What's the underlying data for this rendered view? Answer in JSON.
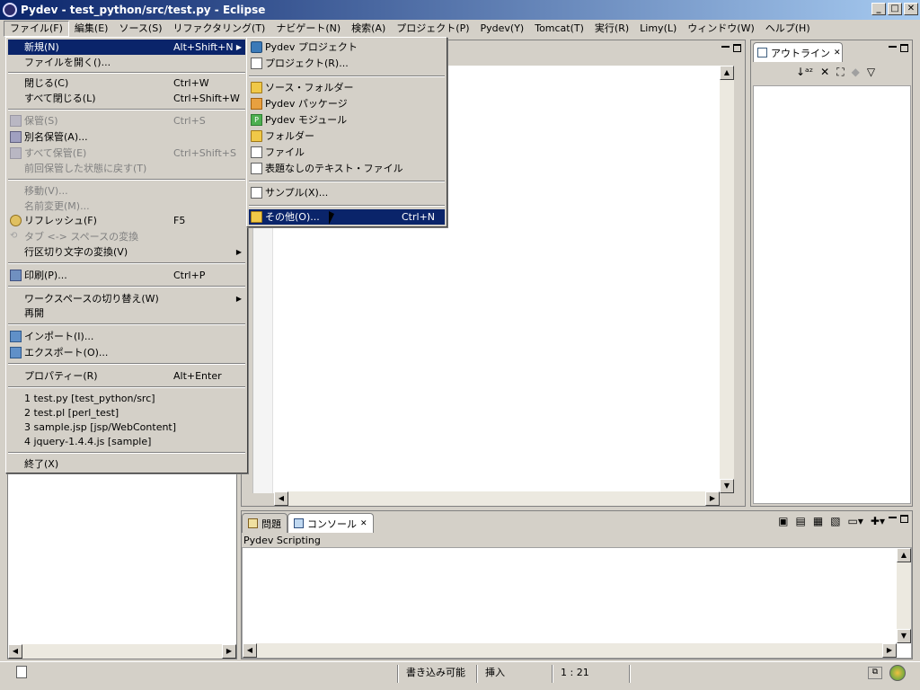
{
  "window": {
    "title": "Pydev - test_python/src/test.py - Eclipse",
    "btn_min": "_",
    "btn_max": "□",
    "btn_close": "✕"
  },
  "menubar": [
    "ファイル(F)",
    "編集(E)",
    "ソース(S)",
    "リファクタリング(T)",
    "ナビゲート(N)",
    "検索(A)",
    "プロジェクト(P)",
    "Pydev(Y)",
    "Tomcat(T)",
    "実行(R)",
    "Limy(L)",
    "ウィンドウ(W)",
    "ヘルプ(H)"
  ],
  "file_menu": {
    "new": {
      "label": "新規(N)",
      "accel": "Alt+Shift+N"
    },
    "open_file": "ファイルを開く()...",
    "close": {
      "label": "閉じる(C)",
      "accel": "Ctrl+W"
    },
    "close_all": {
      "label": "すべて閉じる(L)",
      "accel": "Ctrl+Shift+W"
    },
    "save": {
      "label": "保管(S)",
      "accel": "Ctrl+S"
    },
    "save_as": "別名保管(A)...",
    "save_all": {
      "label": "すべて保管(E)",
      "accel": "Ctrl+Shift+S"
    },
    "revert": "前回保管した状態に戻す(T)",
    "move": "移動(V)...",
    "rename": "名前変更(M)...",
    "refresh": {
      "label": "リフレッシュ(F)",
      "accel": "F5"
    },
    "tab_space": "タブ <-> スペースの変換",
    "line_delim": "行区切り文字の変換(V)",
    "print": {
      "label": "印刷(P)...",
      "accel": "Ctrl+P"
    },
    "switch_ws": "ワークスペースの切り替え(W)",
    "restart": "再開",
    "import": "インポート(I)...",
    "export": "エクスポート(O)...",
    "properties": {
      "label": "プロパティー(R)",
      "accel": "Alt+Enter"
    },
    "recent": [
      "1 test.py  [test_python/src]",
      "2 test.pl  [perl_test]",
      "3 sample.jsp  [jsp/WebContent]",
      "4 jquery-1.4.4.js  [sample]"
    ],
    "exit": "終了(X)"
  },
  "new_menu": {
    "pydev_project": "Pydev プロジェクト",
    "project": "プロジェクト(R)...",
    "source_folder": "ソース・フォルダー",
    "pydev_package": "Pydev パッケージ",
    "pydev_module": "Pydev モジュール",
    "module_icon": "P",
    "folder": "フォルダー",
    "file": "ファイル",
    "untitled_text": "表題なしのテキスト・ファイル",
    "sample": "サンプル(X)...",
    "other": {
      "label": "その他(O)...",
      "accel": "Ctrl+N"
    }
  },
  "outline": {
    "tab": "アウトライン",
    "close": "✕"
  },
  "console": {
    "tab_problems": "問題",
    "tab_console": "コンソール",
    "close": "✕",
    "label": "Pydev Scripting"
  },
  "statusbar": {
    "writable": "書き込み可能",
    "insert": "挿入",
    "position": "1 : 21"
  }
}
